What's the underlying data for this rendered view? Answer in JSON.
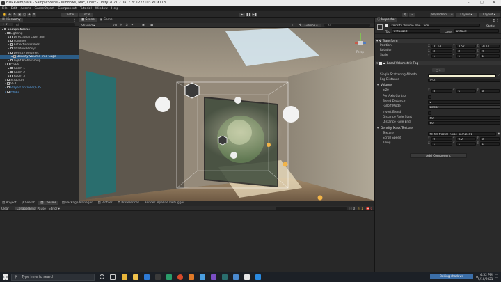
{
  "window": {
    "title": "HDRP-Template - SampleScene - Windows, Mac, Linux - Unity 2021.2.0a17.dt 1272103 <DX11>"
  },
  "menu": [
    "File",
    "Edit",
    "Assets",
    "GameObject",
    "Component",
    "Tutorial",
    "Window",
    "Help"
  ],
  "toolbar": {
    "center": "Center",
    "local": "Local",
    "account": "alejandro S...",
    "layers": "Layers",
    "layout": "Layout"
  },
  "hierarchy": {
    "tab": "Hierarchy",
    "search_placeholder": "All",
    "items": [
      {
        "label": "SampleScene",
        "indent": 0,
        "bold": true
      },
      {
        "label": "Lighting",
        "indent": 1
      },
      {
        "label": "Directional Light Sun",
        "indent": 2
      },
      {
        "label": "Volumes",
        "indent": 2
      },
      {
        "label": "Reflection Probes",
        "indent": 2
      },
      {
        "label": "Shadow Proxys",
        "indent": 2
      },
      {
        "label": "Density Volumes",
        "indent": 2
      },
      {
        "label": "Density Volume Tree Cage",
        "indent": 3,
        "selected": true
      },
      {
        "label": "Light Probe Group",
        "indent": 2
      },
      {
        "label": "Props",
        "indent": 1
      },
      {
        "label": "Room 1",
        "indent": 2
      },
      {
        "label": "Room 2",
        "indent": 2
      },
      {
        "label": "Room 3",
        "indent": 2
      },
      {
        "label": "Structure",
        "indent": 1
      },
      {
        "label": "VFX",
        "indent": 1
      },
      {
        "label": "PlayerController/FPS",
        "indent": 1,
        "blue": true
      },
      {
        "label": "Media",
        "indent": 1,
        "blue": true
      }
    ]
  },
  "scene": {
    "tabs": [
      "Scene",
      "Game"
    ],
    "shading": "Shaded",
    "mode": "2D",
    "gizmos": "Gizmos",
    "search": "All",
    "persp": "Persp"
  },
  "inspector": {
    "tab": "Inspector",
    "object_name": "Density Volume Tree Cage",
    "static_label": "Static",
    "tag_label": "Tag",
    "tag_value": "Untagged",
    "layer_label": "Layer",
    "layer_value": "Default",
    "transform": {
      "header": "Transform",
      "position": {
        "label": "Position",
        "x": "31.58",
        "y": "3.52",
        "z": "-0.14"
      },
      "rotation": {
        "label": "Rotation",
        "x": "0",
        "y": "0",
        "z": "0"
      },
      "scale": {
        "label": "Scale",
        "x": "1",
        "y": "1",
        "z": "1"
      }
    },
    "volumetric": {
      "header": "Local Volumetric Fog",
      "single_scattering_label": "Single Scattering Albedo",
      "fog_distance_label": "Fog Distance",
      "fog_distance": "150",
      "volume_header": "Volume",
      "size_label": "Size",
      "size": {
        "x": "8",
        "y": "6",
        "z": "8"
      },
      "per_axis_label": "Per Axis Control",
      "blend_distance_label": "Blend Distance",
      "blend_distance": "2",
      "falloff_label": "Falloff Mode",
      "falloff": "Linear",
      "invert_label": "Invert Blend",
      "fade_start_label": "Distance Fade Start",
      "fade_start": "50",
      "fade_end_label": "Distance Fade End",
      "fade_end": "60",
      "mask_header": "Density Mask Texture",
      "texture_label": "Texture",
      "texture": "fd_hd_fractal_noise_sample01",
      "scroll_label": "Scroll Speed",
      "scroll": {
        "x": "0",
        "y": "0.2",
        "z": "0"
      },
      "tiling_label": "Tiling",
      "tiling": {
        "x": "1",
        "y": "1",
        "z": "1"
      }
    },
    "add_component": "Add Component",
    "colors": {
      "albedo": "#f3f0d2"
    }
  },
  "bottom": {
    "tabs": [
      "Project",
      "Search",
      "Console",
      "Package Manager",
      "Profiler",
      "Preferences",
      "Render Pipeline Debugger"
    ],
    "console_tools": [
      "Clear",
      "Collapse",
      "Error Pause",
      "Editor"
    ],
    "counts": {
      "info": "0",
      "warn": "1",
      "error": "0"
    }
  },
  "statusbar": {
    "baking": "Baking shadows"
  },
  "taskbar": {
    "search_placeholder": "Type here to search",
    "time": "4:52 PM",
    "date": "5/10/2021"
  }
}
